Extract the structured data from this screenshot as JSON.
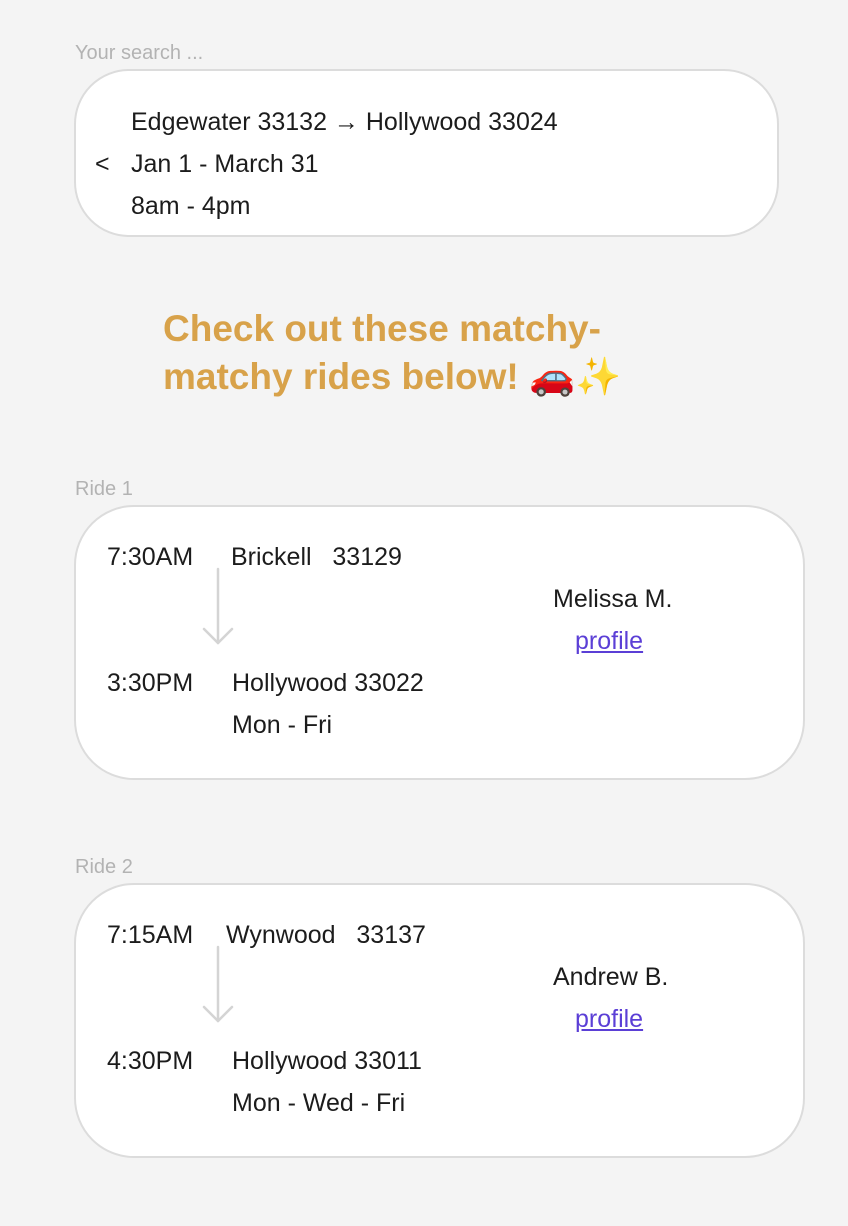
{
  "search": {
    "label": "Your search ...",
    "back_label": "<",
    "route": "Edgewater 33132 → Hollywood 33024",
    "dates": "Jan 1 - March 31",
    "hours": "8am - 4pm"
  },
  "heading": {
    "text": "Check out these matchy-matchy rides below!",
    "emoji": "🚗✨"
  },
  "rides": [
    {
      "label": "Ride 1",
      "depart_time": "7:30AM",
      "depart_place": "Brickell   33129",
      "arrive_time": "3:30PM",
      "arrive_place": "Hollywood 33022",
      "days": "Mon - Fri",
      "driver": "Melissa M.",
      "profile_label": "profile"
    },
    {
      "label": "Ride 2",
      "depart_time": "7:15AM",
      "depart_place": "Wynwood   33137",
      "arrive_time": "4:30PM",
      "arrive_place": "Hollywood 33011",
      "days": "Mon - Wed - Fri",
      "driver": "Andrew B.",
      "profile_label": "profile"
    }
  ],
  "colors": {
    "background": "#f4f4f4",
    "card": "#ffffff",
    "card_border": "#dcdcdc",
    "heading": "#d8a24a",
    "link": "#5b3fd6",
    "muted_label": "#b3b3b3",
    "arrow": "#d4d4d4"
  },
  "icons": {
    "back": "chevron-left-icon",
    "route_arrow": "down-arrow-icon"
  }
}
